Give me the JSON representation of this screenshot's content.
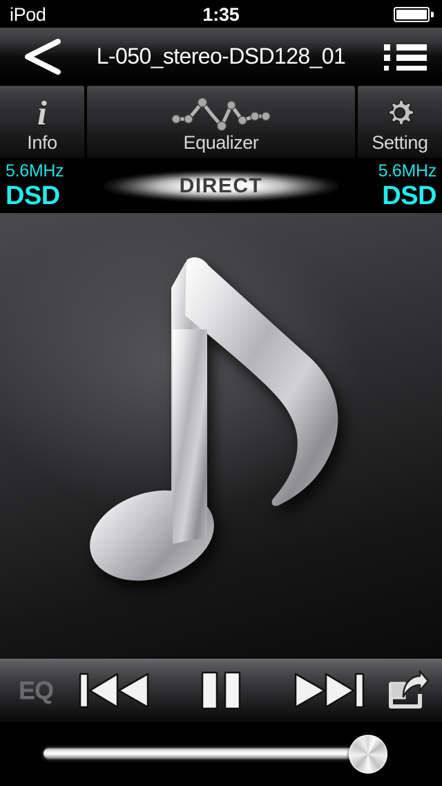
{
  "status_bar": {
    "carrier": "iPod",
    "time": "1:35",
    "battery_icon": "battery-full-icon"
  },
  "nav_bar": {
    "back_icon": "chevron-left-icon",
    "title": "L-050_stereo-DSD128_01",
    "list_icon": "playlist-list-icon"
  },
  "toolbar": {
    "info": {
      "label": "Info",
      "icon": "info-icon"
    },
    "equalizer": {
      "label": "Equalizer",
      "icon": "equalizer-curve-icon"
    },
    "setting": {
      "label": "Setting",
      "icon": "gear-icon"
    }
  },
  "format_status": {
    "left": {
      "rate": "5.6MHz",
      "format": "DSD"
    },
    "right": {
      "rate": "5.6MHz",
      "format": "DSD"
    },
    "mode_badge": "DIRECT",
    "accent_color": "#22ecec"
  },
  "artwork": {
    "icon": "music-note-icon",
    "alt": "music note placeholder artwork"
  },
  "controls": {
    "eq": {
      "label": "EQ",
      "icon": "eq-text-button"
    },
    "previous": {
      "icon": "previous-track-icon"
    },
    "play_pause": {
      "icon": "pause-icon",
      "state": "playing"
    },
    "next": {
      "icon": "next-track-icon"
    },
    "share": {
      "icon": "share-icon"
    }
  },
  "volume_slider": {
    "value_percent": 95,
    "min": 0,
    "max": 100
  }
}
